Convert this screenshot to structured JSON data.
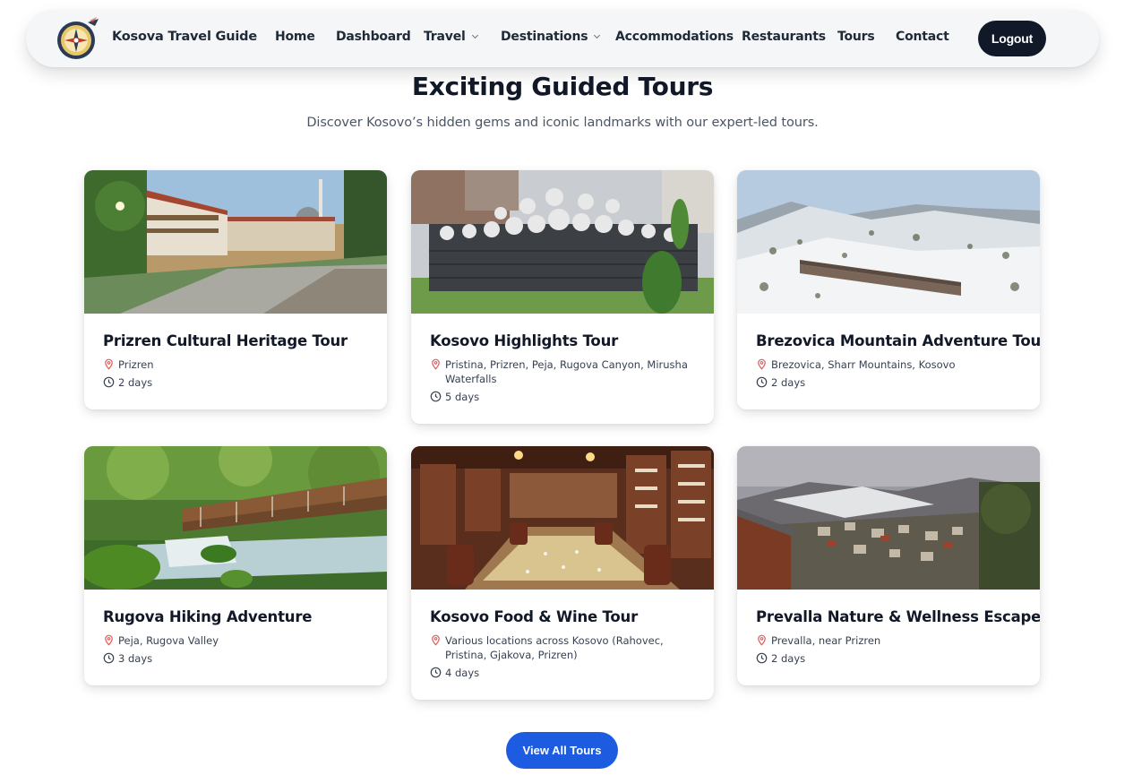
{
  "brand": {
    "name": "Kosova Travel Guide",
    "logo_icon": "compass-globe-logo"
  },
  "nav": {
    "home": "Home",
    "dashboard": "Dashboard",
    "travel": "Travel",
    "destinations": "Destinations",
    "accommodations": "Accommodations",
    "restaurants": "Restaurants",
    "tours": "Tours",
    "contact": "Contact",
    "logout": "Logout"
  },
  "page": {
    "title": "Exciting Guided Tours",
    "subtitle": "Discover Kosovo’s hidden gems and iconic landmarks with our expert-led tours."
  },
  "tours": [
    {
      "name": "Prizren Cultural Heritage Tour",
      "location": "Prizren",
      "duration": "2 days"
    },
    {
      "name": "Kosovo Highlights Tour",
      "location": "Pristina, Prizren, Peja, Rugova Canyon, Mirusha Waterfalls",
      "duration": "5 days"
    },
    {
      "name": "Brezovica Mountain Adventure Tour",
      "location": "Brezovica, Sharr Mountains, Kosovo",
      "duration": "2 days"
    },
    {
      "name": "Rugova Hiking Adventure",
      "location": "Peja, Rugova Valley",
      "duration": "3 days"
    },
    {
      "name": "Kosovo Food & Wine Tour",
      "location": "Various locations across Kosovo (Rahovec, Pristina, Gjakova, Prizren)",
      "duration": "4 days"
    },
    {
      "name": "Prevalla Nature & Wellness Escape",
      "location": "Prevalla, near Prizren",
      "duration": "2 days"
    }
  ],
  "cta": {
    "view_all": "View All Tours"
  },
  "colors": {
    "accent": "#1d5be0",
    "dark": "#111827",
    "pin": "#e05a5a",
    "nav_bg": "#f5f6f8"
  },
  "icons": {
    "location": "map-pin-icon",
    "duration": "clock-icon",
    "dropdown": "chevron-down-icon"
  }
}
